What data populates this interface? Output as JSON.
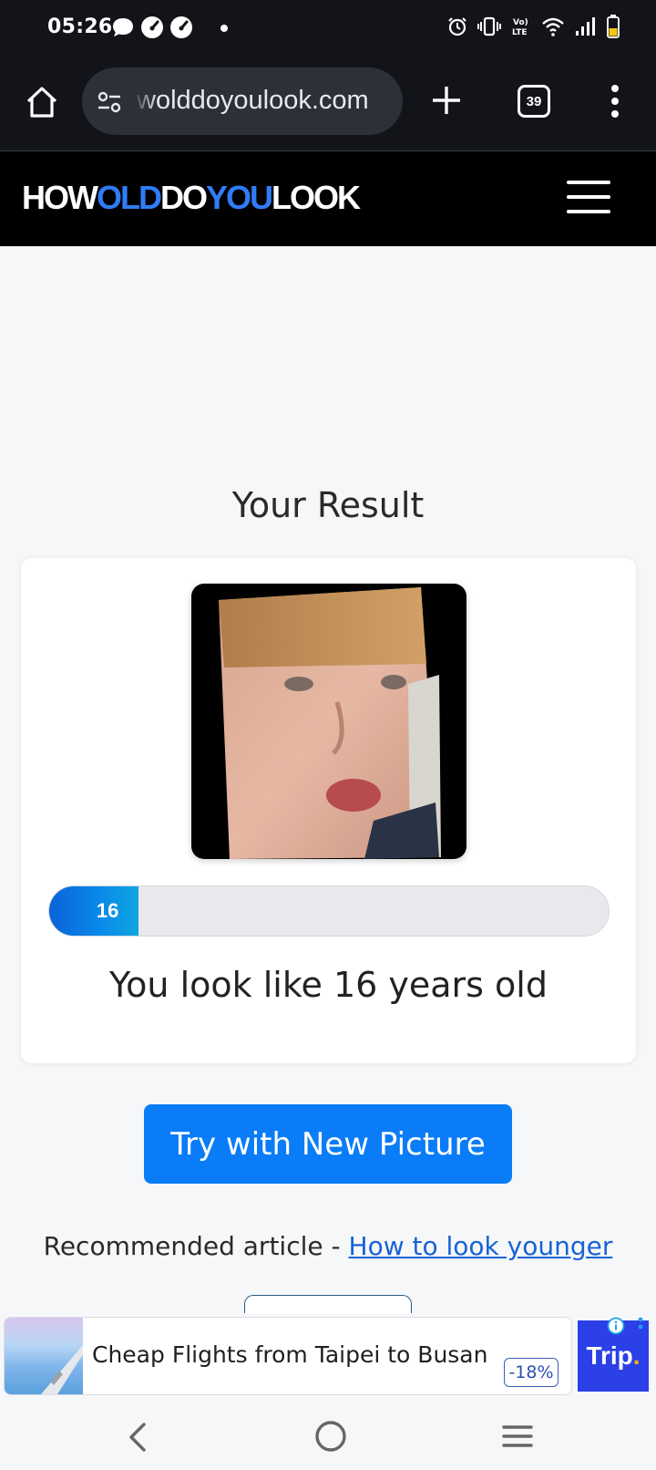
{
  "status_bar": {
    "time": "05:26"
  },
  "browser": {
    "url": "wolddoyoulook.com",
    "tab_count": "39"
  },
  "site": {
    "logo_parts": [
      "HOW",
      "OLD",
      "DO",
      "YOU",
      "LOOK"
    ]
  },
  "result": {
    "heading": "Your Result",
    "age_label": "16",
    "age_progress_fraction": 0.16,
    "text": "You look like 16 years old"
  },
  "actions": {
    "try_button": "Try with New Picture"
  },
  "recommended": {
    "prefix": "Recommended article - ",
    "link": "How to look younger"
  },
  "ad": {
    "title": "Cheap Flights from Taipei to Busan",
    "discount": "-18%",
    "brand": "Trip",
    "brand_dot": "."
  },
  "colors": {
    "brand_blue": "#2f7cf6",
    "button_blue": "#0a7cf7",
    "header_black": "#000000"
  }
}
